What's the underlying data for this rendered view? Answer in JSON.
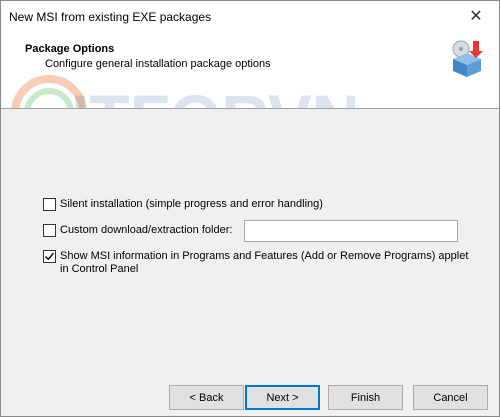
{
  "window": {
    "title": "New MSI from existing EXE packages",
    "close_glyph": "✕"
  },
  "header": {
    "title": "Package Options",
    "subtitle": "Configure general installation package options",
    "icon": "package-install-icon",
    "watermark": "ITFORVN"
  },
  "options": {
    "silent": {
      "label": "Silent installation (simple progress and error handling)",
      "checked": false
    },
    "custom_folder": {
      "label": "Custom download/extraction folder:",
      "checked": false,
      "value": "",
      "placeholder": ""
    },
    "show_msi": {
      "label_line1": "Show MSI information in Programs and Features (Add or Remove Programs) applet",
      "label_line2": "in Control Panel",
      "checked": true
    }
  },
  "buttons": {
    "back": "< Back",
    "next": "Next >",
    "finish": "Finish",
    "cancel": "Cancel"
  },
  "colors": {
    "accent": "#0078d7",
    "watermark_orange": "#e8702a",
    "watermark_green": "#4caf50",
    "watermark_blue": "#2a5fa8"
  }
}
